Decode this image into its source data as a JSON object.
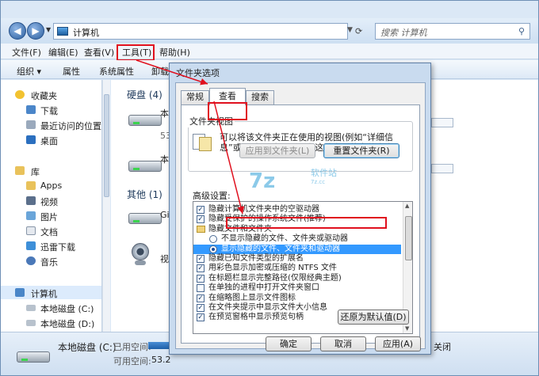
{
  "address": {
    "path": "计算机",
    "chevron": "▸"
  },
  "search": {
    "placeholder": "搜索 计算机"
  },
  "menu": {
    "file": "文件(F)",
    "edit": "编辑(E)",
    "view": "查看(V)",
    "tools": "工具(T)",
    "help": "帮助(H)"
  },
  "toolbar": {
    "organize": "组织 ▾",
    "properties": "属性",
    "system_properties": "系统属性",
    "uninstall_fragment": "卸载"
  },
  "sidebar": {
    "favorites": "收藏夹",
    "downloads": "下载",
    "recent": "最近访问的位置",
    "desktop": "桌面",
    "library": "库",
    "apps": "Apps",
    "videos": "视频",
    "pictures": "图片",
    "documents": "文档",
    "xunlei": "迅雷下载",
    "music": "音乐",
    "computer": "计算机",
    "drive_c": "本地磁盘 (C:)",
    "drive_d": "本地磁盘 (D:)"
  },
  "content": {
    "hard_disks_title": "硬盘 (4)",
    "other_title": "其他 (1)",
    "frag_ben": "本",
    "frag_53": "53",
    "frag_ben2": "本",
    "frag_gi": "Gi",
    "frag_shi": "视"
  },
  "status": {
    "drive_name": "本地磁盘 (C:)",
    "used_label": "已用空间:",
    "free_label": "可用空间:",
    "free_fragment": "53.2",
    "close_fragment": "关闭"
  },
  "dialog": {
    "title": "文件夹选项",
    "tabs": {
      "general": "常规",
      "view": "查看",
      "search": "搜索"
    },
    "folder_views": {
      "legend": "文件夹视图",
      "description": "可以将该文件夹正在使用的视图(例如“详细信息”或“图标”)应用到所有这种类型的文件夹中。",
      "apply_button": "应用到文件夹(L)",
      "reset_button": "重置文件夹(R)"
    },
    "advanced_label": "高级设置:",
    "settings": [
      {
        "text": "隐藏计算机文件夹中的空驱动器",
        "kind": "checkbox",
        "checked": true
      },
      {
        "text": "隐藏受保护的操作系统文件(推荐)",
        "kind": "checkbox",
        "checked": true
      },
      {
        "text": "隐藏文件和文件夹",
        "kind": "folder",
        "checked": false
      },
      {
        "text": "不显示隐藏的文件、文件夹或驱动器",
        "kind": "radio",
        "checked": false
      },
      {
        "text": "显示隐藏的文件、文件夹和驱动器",
        "kind": "radio",
        "checked": true
      },
      {
        "text": "隐藏已知文件类型的扩展名",
        "kind": "checkbox",
        "checked": true
      },
      {
        "text": "用彩色显示加密或压缩的 NTFS 文件",
        "kind": "checkbox",
        "checked": true
      },
      {
        "text": "在标题栏显示完整路径(仅限经典主题)",
        "kind": "checkbox",
        "checked": true
      },
      {
        "text": "在单独的进程中打开文件夹窗口",
        "kind": "checkbox",
        "checked": false
      },
      {
        "text": "在缩略图上显示文件图标",
        "kind": "checkbox",
        "checked": true
      },
      {
        "text": "在文件夹提示中显示文件大小信息",
        "kind": "checkbox",
        "checked": true
      },
      {
        "text": "在预览窗格中显示预览句柄",
        "kind": "checkbox",
        "checked": true
      }
    ],
    "restore_defaults": "还原为默认值(D)",
    "ok": "确定",
    "cancel": "取消",
    "apply": "应用(A)"
  },
  "watermark": {
    "badge": "7z",
    "site": "软件站",
    "url": "7z.cc"
  }
}
